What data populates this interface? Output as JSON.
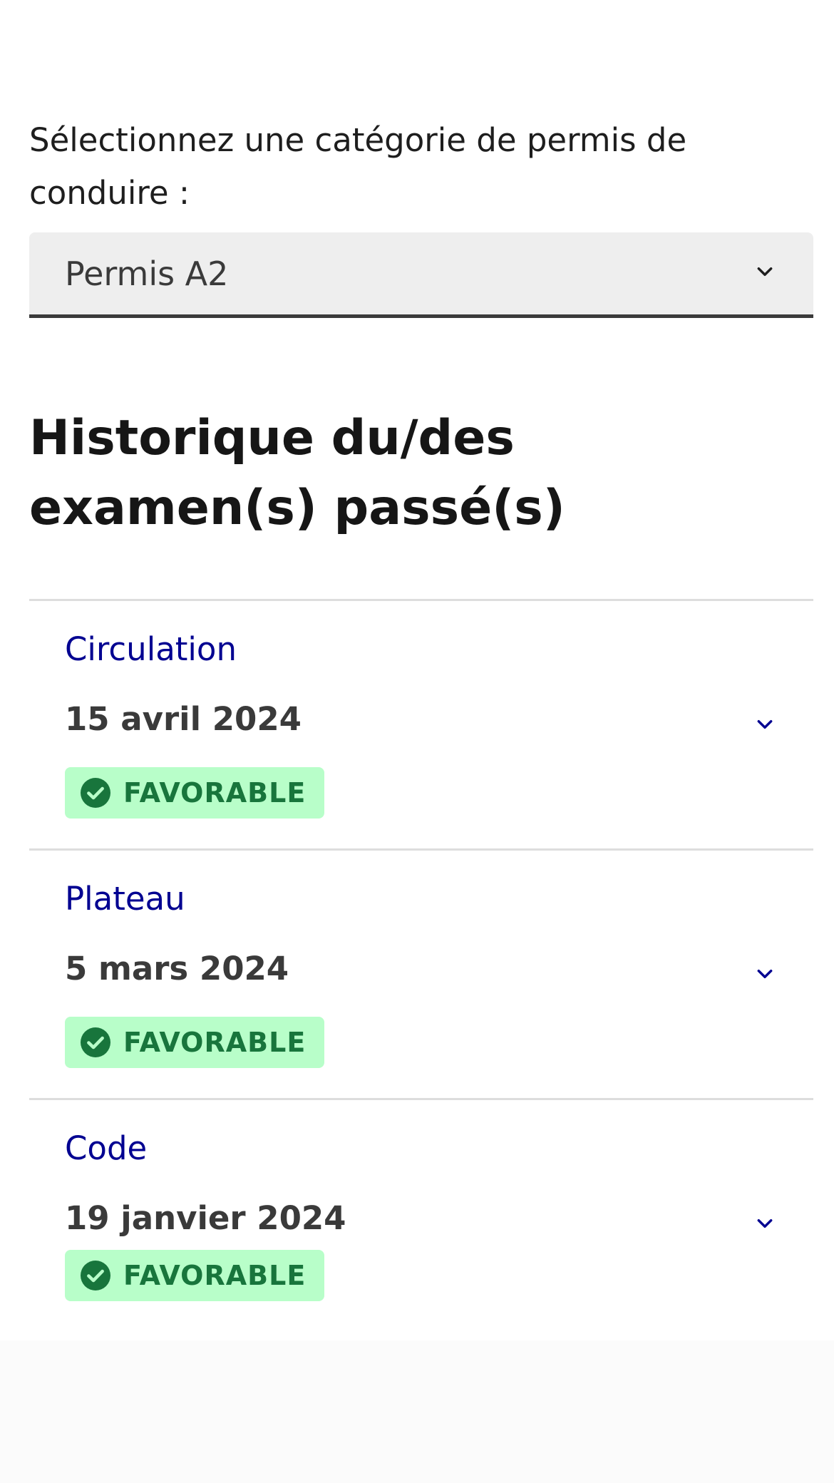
{
  "license_selector": {
    "label": "Sélectionnez une catégorie de permis de conduire :",
    "selected_value": "Permis A2"
  },
  "history": {
    "title": "Historique du/des examen(s) passé(s)",
    "items": [
      {
        "type": "Circulation",
        "date": "15 avril 2024",
        "status": "FAVORABLE"
      },
      {
        "type": "Plateau",
        "date": "5 mars 2024",
        "status": "FAVORABLE"
      },
      {
        "type": "Code",
        "date": "19 janvier 2024",
        "status": "FAVORABLE"
      }
    ]
  },
  "colors": {
    "accent_blue": "#000091",
    "success_bg": "#b8fec9",
    "success_text": "#18753c"
  },
  "icons": {
    "select_chevron": "chevron-down-icon",
    "item_chevron": "chevron-down-icon",
    "status": "check-circle-icon"
  }
}
